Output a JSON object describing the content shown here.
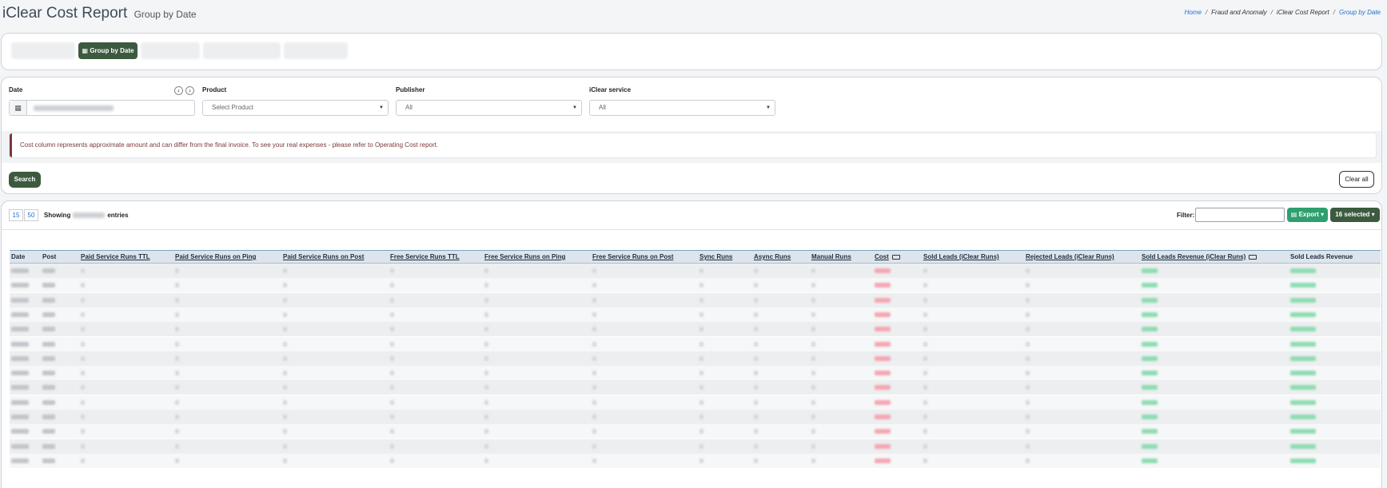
{
  "header": {
    "title": "iClear Cost Report",
    "subtitle": "Group by Date",
    "breadcrumbs": [
      "Home",
      "Fraud and Anomaly",
      "iClear Cost Report",
      "Group by Date"
    ]
  },
  "tabs": [
    {
      "label": "",
      "active": false
    },
    {
      "label": "Group by Date",
      "active": true
    },
    {
      "label": "",
      "active": false
    },
    {
      "label": "",
      "active": false
    },
    {
      "label": "",
      "active": false
    }
  ],
  "filters": {
    "date_label": "Date",
    "product_label": "Product",
    "product_placeholder": "Select Product",
    "publisher_label": "Publisher",
    "publisher_value": "All",
    "service_label": "iClear service",
    "service_value": "All"
  },
  "notice": "Cost column represents approximate amount and can differ from the final invoice. To see your real expenses - please refer to Operating Cost report.",
  "buttons": {
    "search": "Search",
    "clear_all": "Clear all",
    "export": "Export",
    "selected": "16 selected"
  },
  "pagination": {
    "sizes": [
      "15",
      "50"
    ],
    "showing_prefix": "Showing",
    "showing_suffix": "entries"
  },
  "table_filter_label": "Filter:",
  "columns": [
    "Date",
    "Post",
    "Paid Service Runs TTL",
    "Paid Service Runs on Ping",
    "Paid Service Runs on Post",
    "Free Service Runs TTL",
    "Free Service Runs on Ping",
    "Free Service Runs on Post",
    "Sync Runs",
    "Async Runs",
    "Manual Runs",
    "Cost",
    "Sold Leads (iClear Runs)",
    "Rejected Leads (iClear Runs)",
    "Sold Leads Revenue (iClear Runs)",
    "Sold Leads Revenue"
  ],
  "icons": {
    "calendar": "calendar-icon",
    "prev": "arrow-left-icon",
    "next": "arrow-right-icon",
    "export": "file-excel-icon",
    "column_info": "money-icon"
  },
  "colors": {
    "primary": "#3c5a3f",
    "export": "#2e9f6e",
    "link": "#1f6fd1",
    "notice": "#7b3a3a",
    "cost": "#f4a7b3",
    "revenue": "#8fdcb3"
  }
}
